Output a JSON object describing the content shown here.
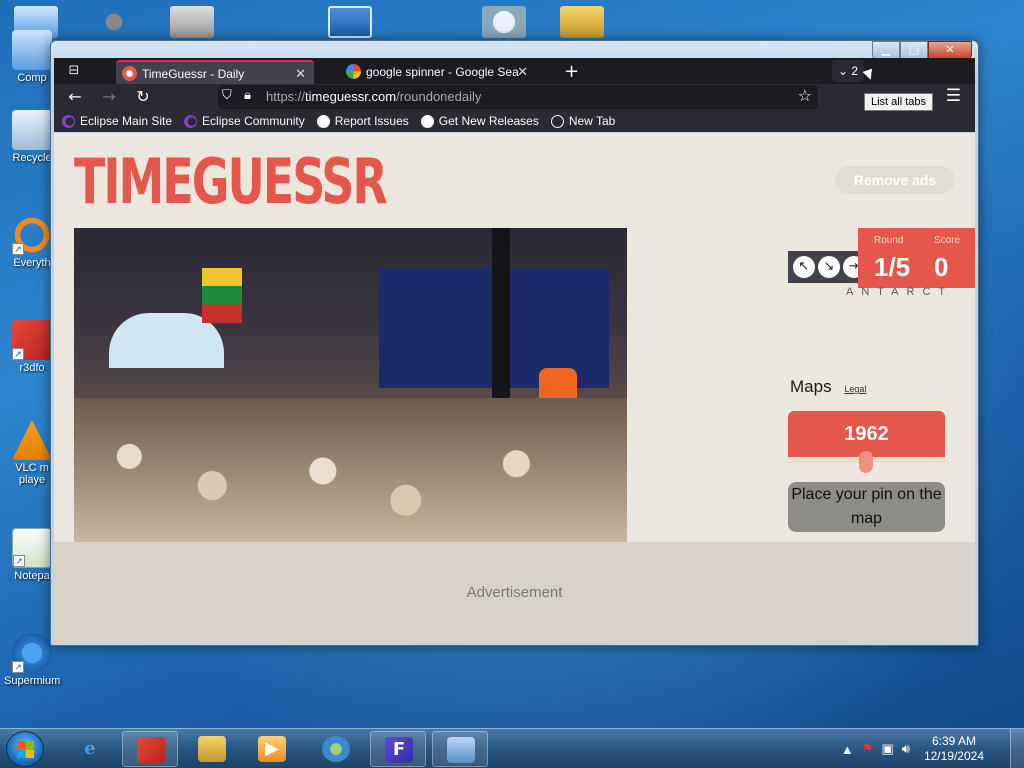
{
  "desktop": {
    "icons": [
      {
        "label": "Comp",
        "top": 0
      },
      {
        "label": "Recycle",
        "top": 0
      },
      {
        "label": "Everyth",
        "top": 0
      },
      {
        "label": "r3dfo",
        "top": 0
      },
      {
        "label": "VLC m\nplaye",
        "top": 0
      },
      {
        "label": "Notepa",
        "top": 0
      },
      {
        "label": "Supermium",
        "top": 0
      }
    ]
  },
  "browser": {
    "tabs": [
      {
        "label": "TimeGuessr - Daily",
        "active": true
      },
      {
        "label": "google spinner - Google Sea",
        "active": false
      }
    ],
    "list_tabs_count": "2",
    "tooltip": "List all tabs",
    "url_prefix": "https://",
    "url_host": "timeguessr.com",
    "url_path": "/roundonedaily",
    "bookmarks": [
      "Eclipse Main Site",
      "Eclipse Community",
      "Report Issues",
      "Get New Releases",
      "New Tab"
    ]
  },
  "page": {
    "logo": "TIMEGUESSR",
    "remove_ads": "Remove ads",
    "round_label": "Round",
    "round_value": "1/5",
    "score_label": "Score",
    "score_value": "0",
    "map_region_text": "ANTARCT",
    "maps_label": "Maps",
    "legal_label": "Legal",
    "year": "1962",
    "pin_button": "Place your pin on the map",
    "advertisement": "Advertisement"
  },
  "taskbar": {
    "time": "6:39 AM",
    "date": "12/19/2024"
  },
  "colors": {
    "brand_red": "#e4574a",
    "page_bg": "#ebe7de",
    "firefox_dark": "#2b2a33",
    "tab_accent": "#e4314a"
  }
}
